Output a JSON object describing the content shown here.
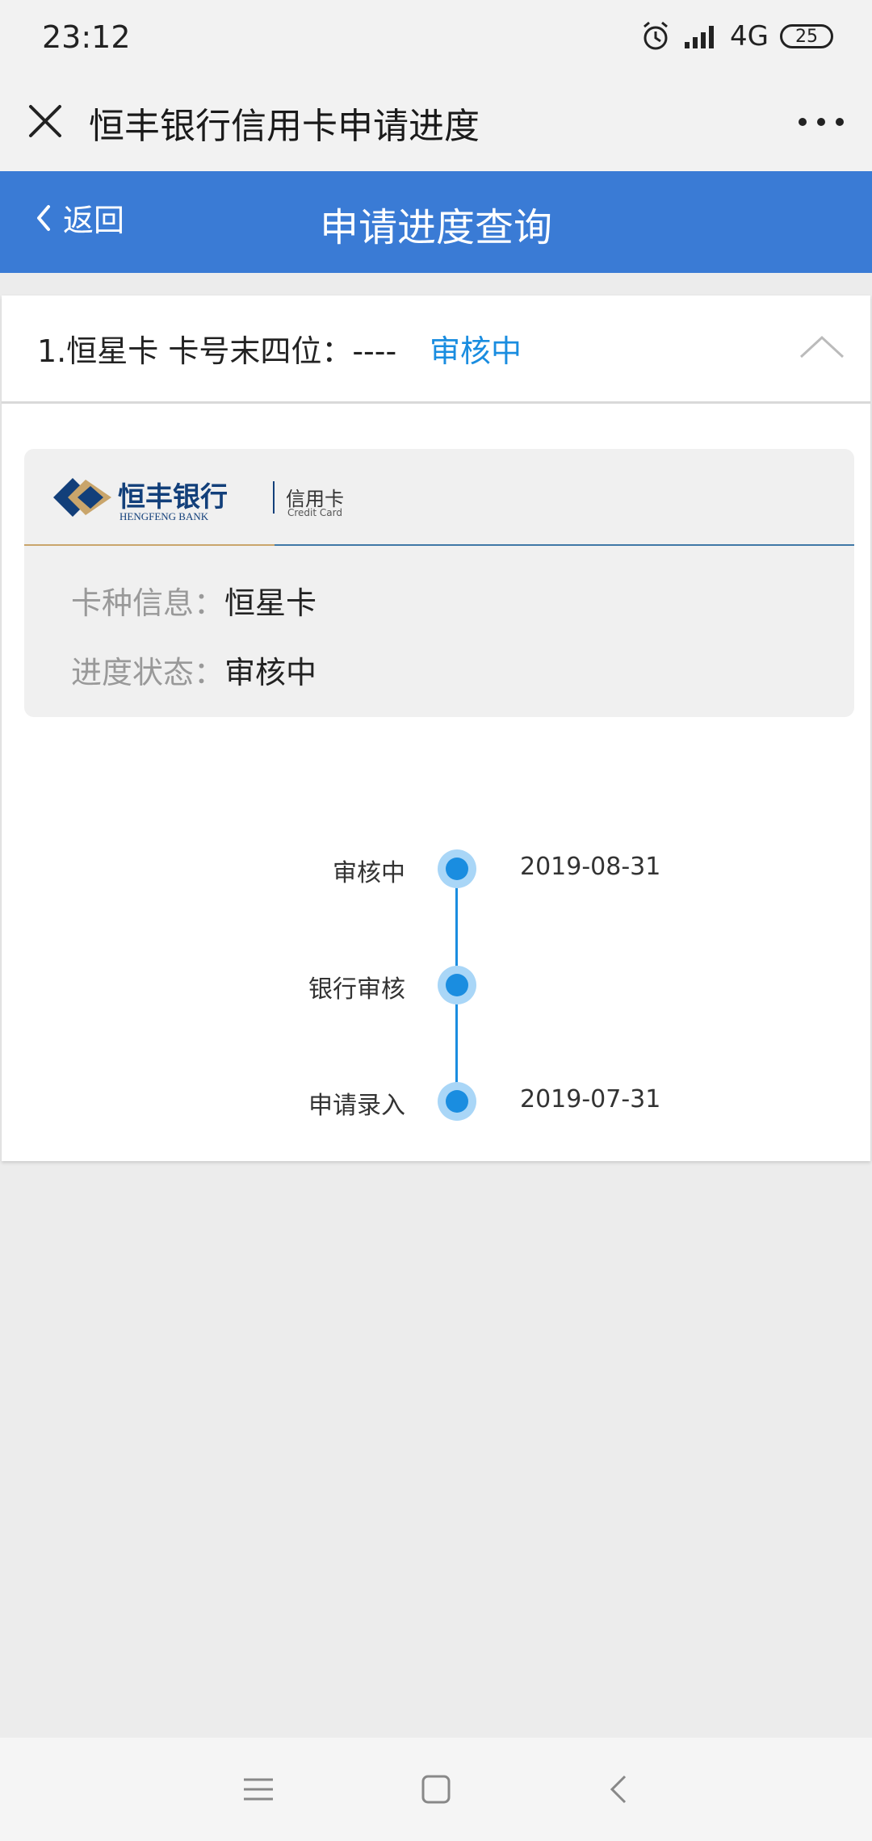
{
  "status_bar": {
    "time": "23:12",
    "network": "4G",
    "battery": "25",
    "icons": [
      "alarm-icon",
      "signal-icon"
    ]
  },
  "wx_header": {
    "title": "恒丰银行信用卡申请进度",
    "close_icon": "close-icon",
    "more_icon": "more-icon"
  },
  "page_header": {
    "back_label": "返回",
    "title": "申请进度查询",
    "background_color": "#3a7bd5"
  },
  "card": {
    "header_text": "1.恒星卡 卡号末四位：----",
    "header_status": "审核中",
    "status_color": "#1a8de0",
    "logo": {
      "bank_name_cn": "恒丰银行",
      "bank_name_en": "HENGFENG BANK",
      "product_cn": "信用卡",
      "product_en": "Credit Card"
    },
    "info": [
      {
        "label": "卡种信息：",
        "value": "恒星卡"
      },
      {
        "label": "进度状态：",
        "value": "审核中"
      }
    ],
    "timeline": [
      {
        "label": "审核中",
        "date": "2019-08-31"
      },
      {
        "label": "银行审核",
        "date": ""
      },
      {
        "label": "申请录入",
        "date": "2019-07-31"
      }
    ]
  },
  "nav_bar": {
    "icons": [
      "menu-icon",
      "home-icon",
      "back-icon"
    ]
  }
}
